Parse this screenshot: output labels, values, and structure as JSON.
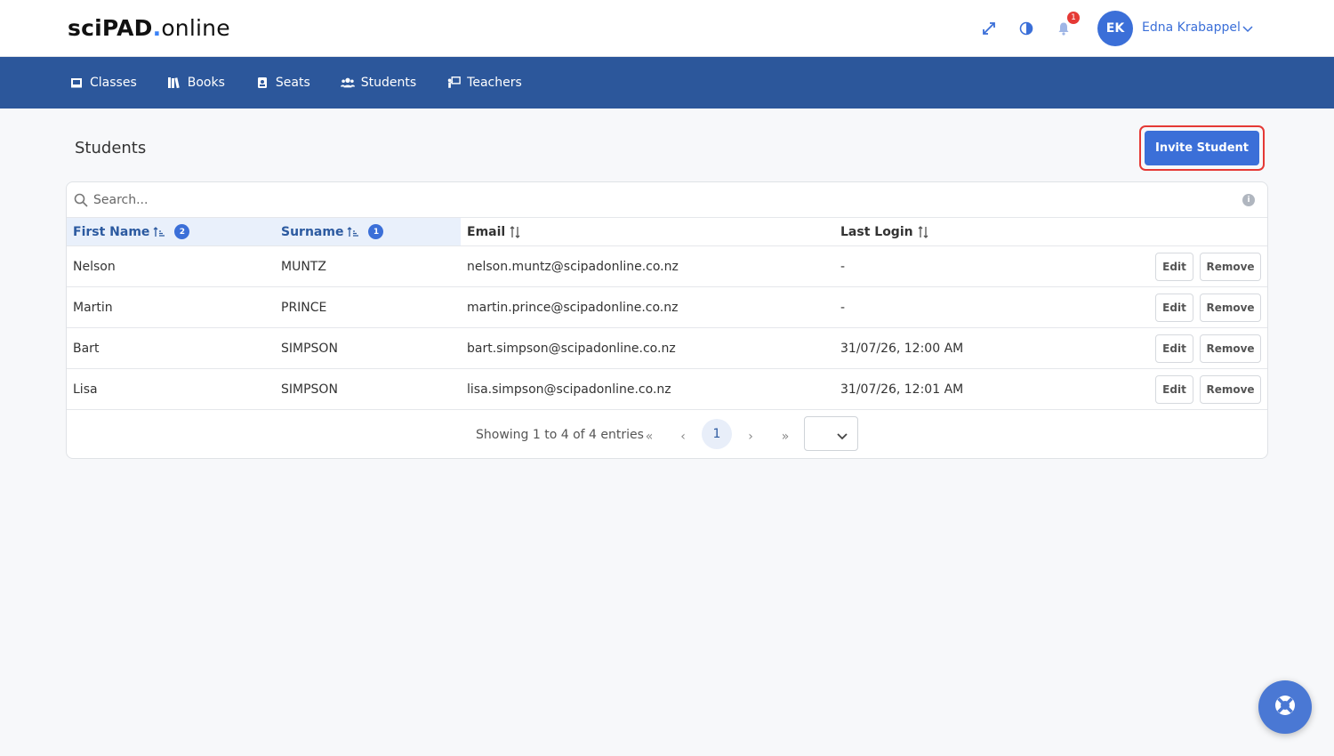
{
  "header": {
    "logo_bold": "sciPAD",
    "logo_dot": ".",
    "logo_thin": "online",
    "notification_count": "1",
    "user_initials": "EK",
    "user_name": "Edna Krabappel",
    "icons": [
      "expand-icon",
      "contrast-icon",
      "bell-icon",
      "chevron-down-icon"
    ]
  },
  "nav": {
    "items": [
      {
        "label": "Classes",
        "icon": "whiteboard-icon"
      },
      {
        "label": "Books",
        "icon": "books-icon"
      },
      {
        "label": "Seats",
        "icon": "seat-icon"
      },
      {
        "label": "Students",
        "icon": "students-icon"
      },
      {
        "label": "Teachers",
        "icon": "teacher-icon"
      }
    ]
  },
  "page": {
    "title": "Students",
    "invite_label": "Invite Student"
  },
  "table": {
    "search_placeholder": "Search...",
    "columns": [
      {
        "label": "First Name",
        "sort_order": "2",
        "sorted": true
      },
      {
        "label": "Surname",
        "sort_order": "1",
        "sorted": true
      },
      {
        "label": "Email",
        "sorted": false
      },
      {
        "label": "Last Login",
        "sorted": false
      }
    ],
    "rows": [
      {
        "first": "Nelson",
        "surname": "MUNTZ",
        "email": "nelson.muntz@scipadonline.co.nz",
        "last_login": "-"
      },
      {
        "first": "Martin",
        "surname": "PRINCE",
        "email": "martin.prince@scipadonline.co.nz",
        "last_login": "-"
      },
      {
        "first": "Bart",
        "surname": "SIMPSON",
        "email": "bart.simpson@scipadonline.co.nz",
        "last_login": "31/07/26, 12:00 AM"
      },
      {
        "first": "Lisa",
        "surname": "SIMPSON",
        "email": "lisa.simpson@scipadonline.co.nz",
        "last_login": "31/07/26, 12:01 AM"
      }
    ],
    "edit_label": "Edit",
    "remove_label": "Remove"
  },
  "pager": {
    "info": "Showing 1 to 4 of 4 entries",
    "first": "«",
    "prev": "‹",
    "current_page": "1",
    "next": "›",
    "last": "»"
  },
  "colors": {
    "navbar": "#2c579b",
    "accent": "#3b6fd8",
    "highlight_border": "#e53935"
  }
}
